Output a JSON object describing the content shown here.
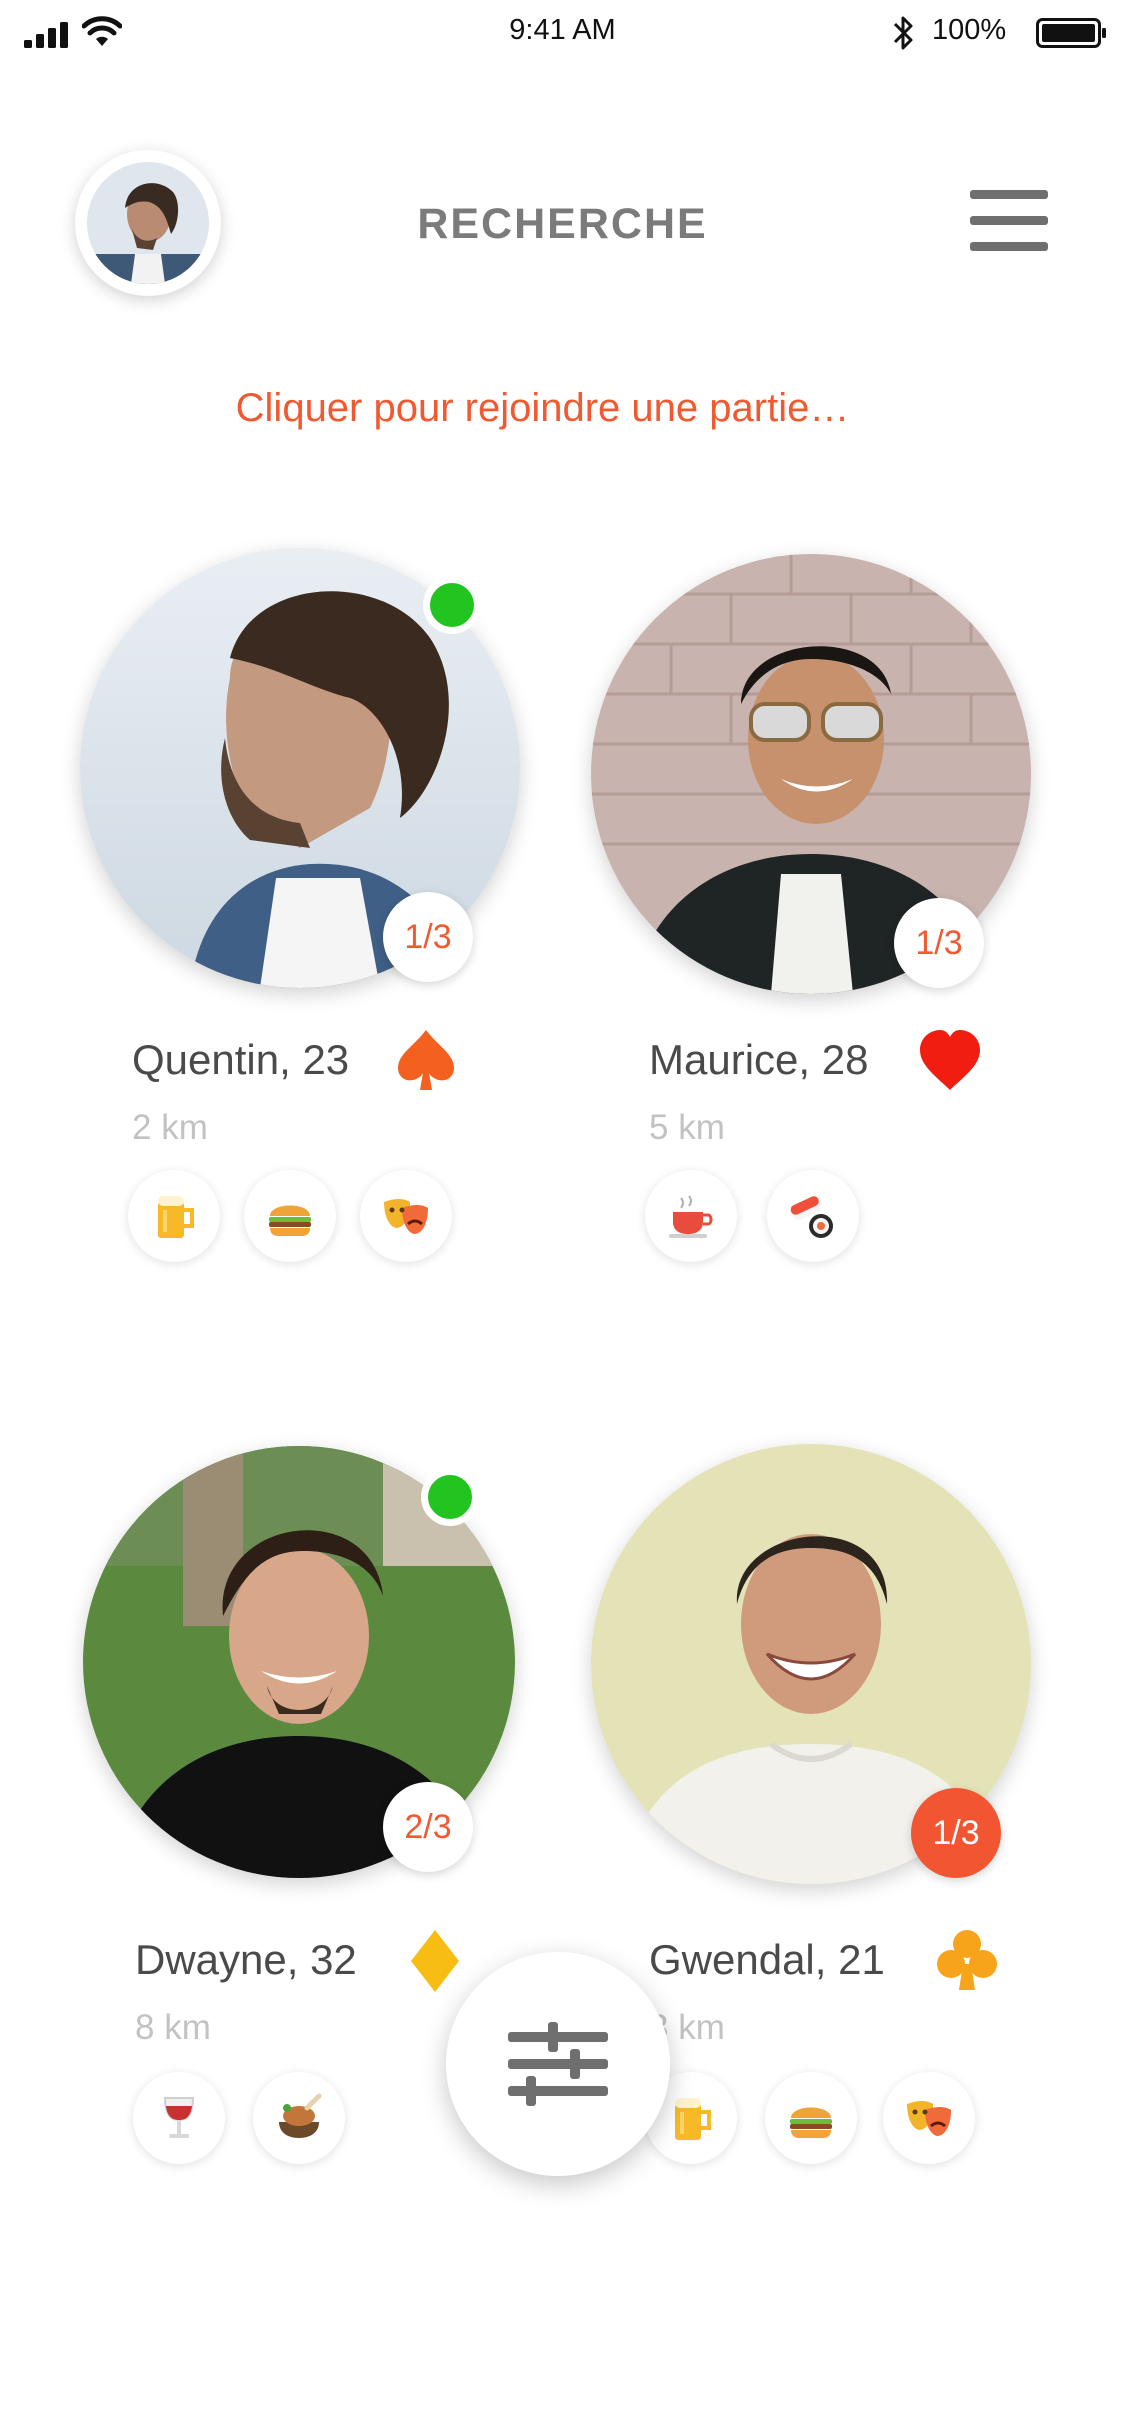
{
  "status_bar": {
    "time": "9:41 AM",
    "battery_text": "100%",
    "icons": [
      "signal-icon",
      "wifi-icon",
      "bluetooth-icon",
      "battery-icon"
    ]
  },
  "header": {
    "title": "RECHERCHE",
    "avatar_icon": "user-avatar",
    "menu_icon": "hamburger-menu-icon"
  },
  "hint": "Cliquer pour rejoindre une partie…",
  "colors": {
    "accent": "#f15a31",
    "online": "#22c51f",
    "title_gray": "#7b7b7b",
    "distance_gray": "#c2c2c2"
  },
  "players": [
    {
      "name": "Quentin, 23",
      "distance": "2 km",
      "slots": "1/3",
      "online": true,
      "suit": "spade",
      "interests": [
        "beer-icon",
        "burger-icon",
        "theater-masks-icon"
      ]
    },
    {
      "name": "Maurice, 28",
      "distance": "5 km",
      "slots": "1/3",
      "online": false,
      "suit": "heart",
      "interests": [
        "coffee-icon",
        "sushi-icon"
      ]
    },
    {
      "name": "Dwayne, 32",
      "distance": "8 km",
      "slots": "2/3",
      "online": true,
      "suit": "diamond",
      "interests": [
        "wine-icon",
        "food-icon"
      ]
    },
    {
      "name": "Gwendal, 21",
      "distance": "3 km",
      "slots": "1/3",
      "online": false,
      "suit": "club",
      "interests": [
        "beer-icon",
        "burger-icon",
        "theater-masks-icon"
      ]
    }
  ],
  "filter_button_icon": "filter-sliders-icon"
}
